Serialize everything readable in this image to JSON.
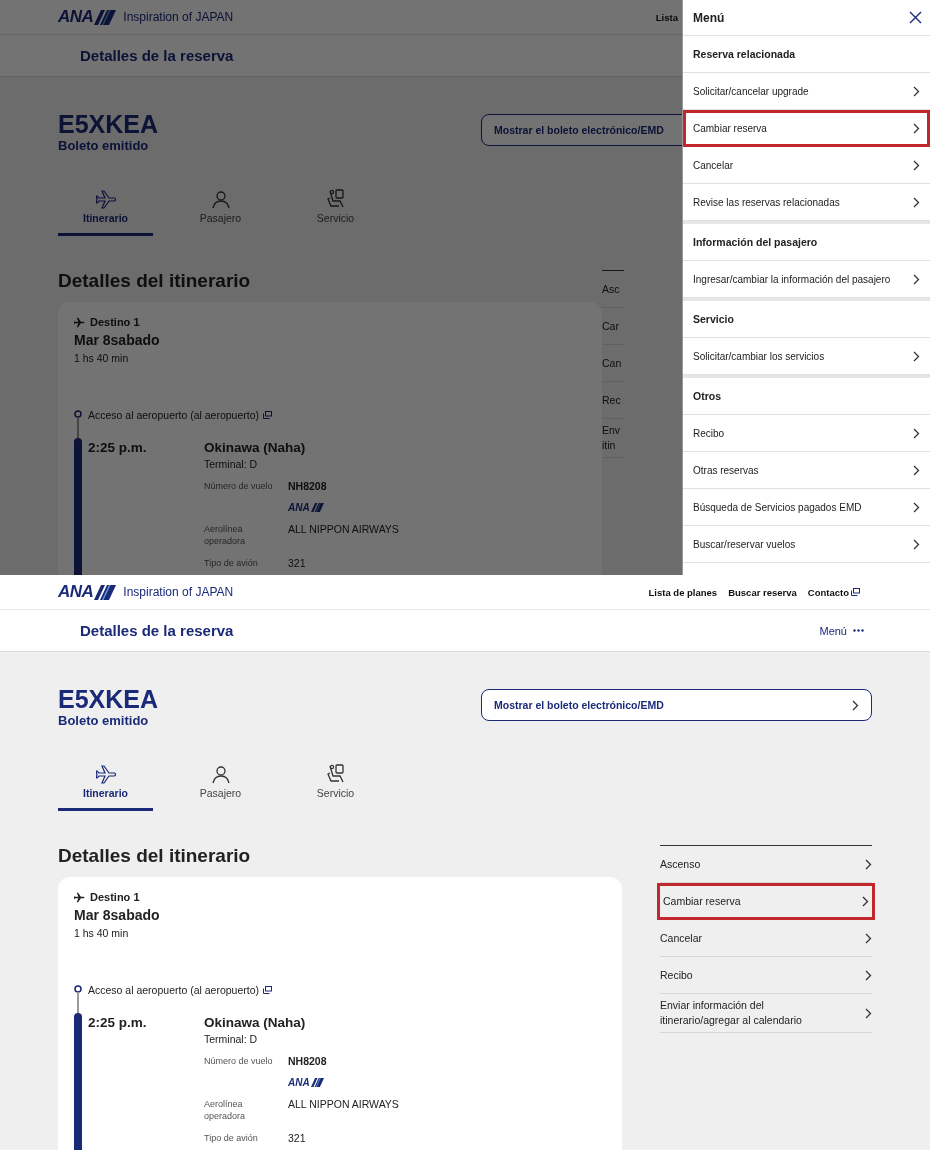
{
  "screens": [
    {
      "kind": "menu_open",
      "header": {
        "logo": "ANA",
        "tagline": "Inspiration of JAPAN",
        "links": [
          {
            "label": "Lista",
            "external": false
          }
        ]
      },
      "subheader": {
        "title": "Detalles de la reserva"
      },
      "booking": {
        "code": "E5XKEA",
        "status": "Boleto emitido",
        "ticket_button": "Mostrar el boleto electrónico/EMD"
      },
      "tabs": [
        {
          "label": "Itinerario",
          "kind": "plane",
          "selected": true
        },
        {
          "label": "Pasajero",
          "kind": "person",
          "selected": false
        },
        {
          "label": "Servicio",
          "kind": "seat",
          "selected": false
        }
      ],
      "itinerary": {
        "heading": "Detalles del itinerario",
        "segment": {
          "label": "Destino 1",
          "date": "Mar 8sabado",
          "duration": "1 hs 40 min",
          "access": "Acceso al aeropuerto (al aeropuerto)",
          "time": "2:25 p.m.",
          "airport": "Okinawa (Naha)",
          "terminal": "Terminal: D",
          "airline_logo": "ANA",
          "details": [
            {
              "kind": "flight",
              "label": "Número de vuelo",
              "value": "NH8208"
            },
            {
              "kind": "logo"
            },
            {
              "kind": "text",
              "label": "Aerolínea operadora",
              "value": "ALL NIPPON AIRWAYS"
            },
            {
              "kind": "text",
              "label": "Tipo de avión",
              "value": "321"
            }
          ]
        }
      },
      "side_menu": [
        {
          "label": "Asc",
          "highlighted": false
        },
        {
          "label": "Car",
          "highlighted": false
        },
        {
          "label": "Can",
          "highlighted": false
        },
        {
          "label": "Rec",
          "highlighted": false
        },
        {
          "label": "Env itin",
          "highlighted": false
        }
      ],
      "drawer": {
        "title": "Menú",
        "sections": [
          {
            "heading": "Reserva relacionada",
            "items": [
              {
                "label": "Solicitar/cancelar upgrade",
                "highlighted": false
              },
              {
                "label": "Cambiar reserva",
                "highlighted": true
              },
              {
                "label": "Cancelar",
                "highlighted": false
              },
              {
                "label": "Revise las reservas relacionadas",
                "highlighted": false
              }
            ]
          },
          {
            "heading": "Información del pasajero",
            "items": [
              {
                "label": "Ingresar/cambiar la información del pasajero",
                "highlighted": false
              }
            ]
          },
          {
            "heading": "Servicio",
            "items": [
              {
                "label": "Solicitar/cambiar los servicios",
                "highlighted": false
              }
            ]
          },
          {
            "heading": "Otros",
            "items": [
              {
                "label": "Recibo",
                "highlighted": false
              },
              {
                "label": "Otras reservas",
                "highlighted": false
              },
              {
                "label": "Búsqueda de Servicios pagados EMD",
                "highlighted": false
              },
              {
                "label": "Buscar/reservar vuelos",
                "highlighted": false
              }
            ]
          }
        ]
      }
    },
    {
      "kind": "plain",
      "header": {
        "logo": "ANA",
        "tagline": "Inspiration of JAPAN",
        "links": [
          {
            "label": "Lista de planes",
            "external": false
          },
          {
            "label": "Buscar reserva",
            "external": false
          },
          {
            "label": "Contacto",
            "external": true
          }
        ]
      },
      "subheader": {
        "title": "Detalles de la reserva",
        "menu_label": "Menú"
      },
      "booking": {
        "code": "E5XKEA",
        "status": "Boleto emitido",
        "ticket_button": "Mostrar el boleto electrónico/EMD"
      },
      "tabs": [
        {
          "label": "Itinerario",
          "kind": "plane",
          "selected": true
        },
        {
          "label": "Pasajero",
          "kind": "person",
          "selected": false
        },
        {
          "label": "Servicio",
          "kind": "seat",
          "selected": false
        }
      ],
      "itinerary": {
        "heading": "Detalles del itinerario",
        "segment": {
          "label": "Destino 1",
          "date": "Mar 8sabado",
          "duration": "1 hs 40 min",
          "access": "Acceso al aeropuerto (al aeropuerto)",
          "time": "2:25 p.m.",
          "airport": "Okinawa (Naha)",
          "terminal": "Terminal: D",
          "airline_logo": "ANA",
          "details": [
            {
              "kind": "flight",
              "label": "Número de vuelo",
              "value": "NH8208"
            },
            {
              "kind": "logo"
            },
            {
              "kind": "text",
              "label": "Aerolínea operadora",
              "value": "ALL NIPPON AIRWAYS"
            },
            {
              "kind": "text",
              "label": "Tipo de avión",
              "value": "321"
            }
          ]
        }
      },
      "side_menu": [
        {
          "label": "Ascenso",
          "highlighted": false
        },
        {
          "label": "Cambiar reserva",
          "highlighted": true
        },
        {
          "label": "Cancelar",
          "highlighted": false
        },
        {
          "label": "Recibo",
          "highlighted": false
        },
        {
          "label": "Enviar información del itinerario/agregar al calendario",
          "highlighted": false
        }
      ]
    }
  ]
}
